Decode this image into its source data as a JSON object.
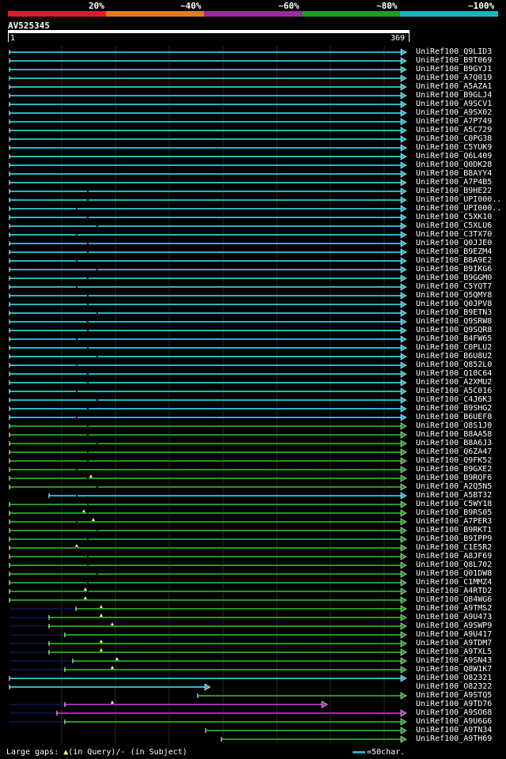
{
  "header": {
    "percent_labels": [
      "20%",
      "~40%",
      "~60%",
      "~80%",
      "~100%"
    ],
    "identity_colors": [
      "#e8162c",
      "#e87a1e",
      "#9a2aa0",
      "#1aa01a",
      "#1ab4c0"
    ],
    "query_id": "AV525345",
    "ruler_start": "1",
    "ruler_end": "369"
  },
  "colors": {
    "cyan": "#22b7c8",
    "green": "#1e9a1e",
    "magenta": "#a02aa8",
    "navy": "#0d1240",
    "gap": "#ffff80"
  },
  "hits": [
    {
      "label": "UniRef100_Q9LID3",
      "color": "cyan"
    },
    {
      "label": "UniRef100_B9T069",
      "color": "cyan"
    },
    {
      "label": "UniRef100_B9GYJ1",
      "color": "cyan"
    },
    {
      "label": "UniRef100_A7Q019",
      "color": "cyan"
    },
    {
      "label": "UniRef100_A5AZA1",
      "color": "cyan"
    },
    {
      "label": "UniRef100_B9GLJ4",
      "color": "cyan"
    },
    {
      "label": "UniRef100_A9SCV1",
      "color": "cyan"
    },
    {
      "label": "UniRef100_A9SX02",
      "color": "cyan"
    },
    {
      "label": "UniRef100_A7P749",
      "color": "cyan"
    },
    {
      "label": "UniRef100_A5C729",
      "color": "cyan"
    },
    {
      "label": "UniRef100_C0PG38",
      "color": "cyan"
    },
    {
      "label": "UniRef100_C5YUK9",
      "color": "cyan"
    },
    {
      "label": "UniRef100_Q6L409",
      "color": "cyan"
    },
    {
      "label": "UniRef100_Q0DK28",
      "color": "cyan"
    },
    {
      "label": "UniRef100_B8AYY4",
      "color": "cyan"
    },
    {
      "label": "UniRef100_A7P4B5",
      "color": "cyan"
    },
    {
      "label": "UniRef100_B9HE22",
      "color": "cyan"
    },
    {
      "label": "UniRef100_UPI000..",
      "color": "cyan"
    },
    {
      "label": "UniRef100_UPI000..",
      "color": "cyan"
    },
    {
      "label": "UniRef100_C5XK10",
      "color": "cyan"
    },
    {
      "label": "UniRef100_C5XLU6",
      "color": "cyan"
    },
    {
      "label": "UniRef100_C3TX70",
      "color": "cyan"
    },
    {
      "label": "UniRef100_Q0JJE0",
      "color": "cyan"
    },
    {
      "label": "UniRef100_B9EZM4",
      "color": "cyan"
    },
    {
      "label": "UniRef100_B8A9E2",
      "color": "cyan"
    },
    {
      "label": "UniRef100_B9IKG6",
      "color": "cyan"
    },
    {
      "label": "UniRef100_B9GGM0",
      "color": "cyan"
    },
    {
      "label": "UniRef100_C5YQT7",
      "color": "cyan"
    },
    {
      "label": "UniRef100_Q5QMY8",
      "color": "cyan"
    },
    {
      "label": "UniRef100_Q0JPV8",
      "color": "cyan"
    },
    {
      "label": "UniRef100_B9ETN3",
      "color": "cyan"
    },
    {
      "label": "UniRef100_Q9SRW8",
      "color": "cyan"
    },
    {
      "label": "UniRef100_Q9SQR8",
      "color": "cyan"
    },
    {
      "label": "UniRef100_B4FW65",
      "color": "cyan"
    },
    {
      "label": "UniRef100_C0PLU2",
      "color": "cyan"
    },
    {
      "label": "UniRef100_B6U8U2",
      "color": "cyan"
    },
    {
      "label": "UniRef100_Q852L0",
      "color": "cyan"
    },
    {
      "label": "UniRef100_Q10C64",
      "color": "cyan"
    },
    {
      "label": "UniRef100_A2XMU2",
      "color": "cyan"
    },
    {
      "label": "UniRef100_A5C016",
      "color": "cyan"
    },
    {
      "label": "UniRef100_C4J6K3",
      "color": "cyan"
    },
    {
      "label": "UniRef100_B9SHG2",
      "color": "cyan"
    },
    {
      "label": "UniRef100_B6UEF8",
      "color": "cyan"
    },
    {
      "label": "UniRef100_Q8S1J0",
      "color": "green"
    },
    {
      "label": "UniRef100_B8AA58",
      "color": "green"
    },
    {
      "label": "UniRef100_B8A6J3",
      "color": "green"
    },
    {
      "label": "UniRef100_Q6ZA47",
      "color": "green"
    },
    {
      "label": "UniRef100_Q9FK52",
      "color": "green"
    },
    {
      "label": "UniRef100_B9GXE2",
      "color": "green"
    },
    {
      "label": "UniRef100_B9RQF6",
      "color": "green"
    },
    {
      "label": "UniRef100_A2Q5N5",
      "color": "green"
    },
    {
      "label": "UniRef100_A5BT32",
      "color": "cyan"
    },
    {
      "label": "UniRef100_C5WY18",
      "color": "green"
    },
    {
      "label": "UniRef100_B9RS05",
      "color": "green"
    },
    {
      "label": "UniRef100_A7PER3",
      "color": "green"
    },
    {
      "label": "UniRef100_B9RKT1",
      "color": "green"
    },
    {
      "label": "UniRef100_B9IPP9",
      "color": "green"
    },
    {
      "label": "UniRef100_C1E5R2",
      "color": "green"
    },
    {
      "label": "UniRef100_A8JF69",
      "color": "green"
    },
    {
      "label": "UniRef100_Q8L702",
      "color": "green"
    },
    {
      "label": "UniRef100_Q01DW8",
      "color": "green"
    },
    {
      "label": "UniRef100_C1MMZ4",
      "color": "green"
    },
    {
      "label": "UniRef100_A4RTD2",
      "color": "green"
    },
    {
      "label": "UniRef100_Q84WG6",
      "color": "green"
    },
    {
      "label": "UniRef100_A9TMS2",
      "color": "green"
    },
    {
      "label": "UniRef100_A9U473",
      "color": "green"
    },
    {
      "label": "UniRef100_A9SWP9",
      "color": "green"
    },
    {
      "label": "UniRef100_A9U417",
      "color": "green"
    },
    {
      "label": "UniRef100_A9TDM7",
      "color": "green"
    },
    {
      "label": "UniRef100_A9TXL5",
      "color": "green"
    },
    {
      "label": "UniRef100_A9SN43",
      "color": "green"
    },
    {
      "label": "UniRef100_Q8W1K7",
      "color": "green"
    },
    {
      "label": "UniRef100_O82321",
      "color": "cyan"
    },
    {
      "label": "UniRef100_O82322",
      "color": "cyan"
    },
    {
      "label": "UniRef100_A9STQ5",
      "color": "green"
    },
    {
      "label": "UniRef100_A9TD76",
      "color": "magenta"
    },
    {
      "label": "UniRef100_A9SO68",
      "color": "magenta"
    },
    {
      "label": "UniRef100_A9U6G6",
      "color": "green"
    },
    {
      "label": "UniRef100_A9TN34",
      "color": "green"
    },
    {
      "label": "UniRef100_A9TH69",
      "color": "green"
    }
  ],
  "footer": {
    "legend_prefix": "Large gaps: ",
    "query_marker": "▲",
    "query_text": "(in Query)/",
    "subject_marker": "-",
    "subject_text": " (in Subject)",
    "scale_text": "=50char."
  }
}
